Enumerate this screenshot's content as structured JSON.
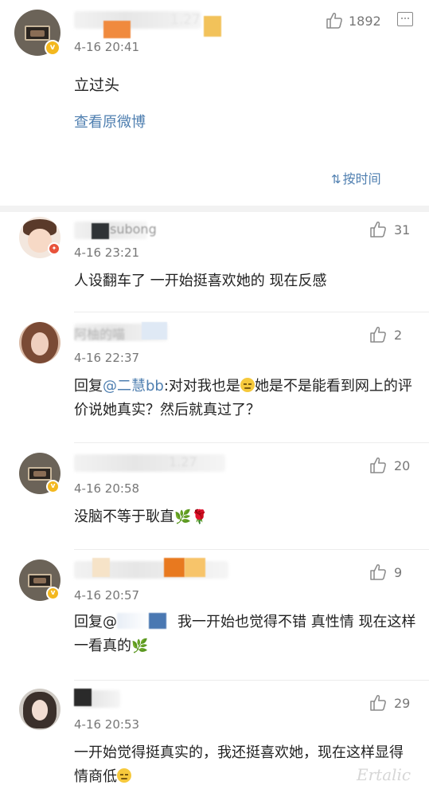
{
  "post": {
    "time": "4-16 20:41",
    "text": "立过头",
    "view_original": "查看原微博",
    "like_count": "1892",
    "sort_label": "按时间",
    "author_name_partial": "1.27"
  },
  "comments": [
    {
      "name_partial": "subong",
      "time": "4-16 23:21",
      "text": "人设翻车了 一开始挺喜欢她的 现在反感",
      "likes": "31"
    },
    {
      "name_partial": "阿柚的喵",
      "time": "4-16 22:37",
      "reply_prefix": "回复",
      "mention": "@二慧bb",
      "text_a": ":对对我也是",
      "text_b": "她是不是能看到网上的评价说她真实？然后就真过了？",
      "likes": "2"
    },
    {
      "name_partial": "1.27",
      "time": "4-16 20:58",
      "text": "没脑不等于耿直",
      "likes": "20"
    },
    {
      "time": "4-16 20:57",
      "reply_prefix": "回复@",
      "text": "我一开始也觉得不错 真性情 现在这样一看真的",
      "likes": "9"
    },
    {
      "time": "4-16 20:53",
      "text_a": "一开始觉得挺真实的，我还挺喜欢她，现在这样显得情商低",
      "likes": "29"
    }
  ],
  "colors": {
    "link": "#4f7fb0",
    "meta": "#777777",
    "verified": "#f3b81f"
  },
  "icons": {
    "like": "thumb-up-icon",
    "more": "comment-more-icon",
    "sort": "sort-icon",
    "verified": "verified-badge-icon"
  },
  "watermark": "Ertalic"
}
